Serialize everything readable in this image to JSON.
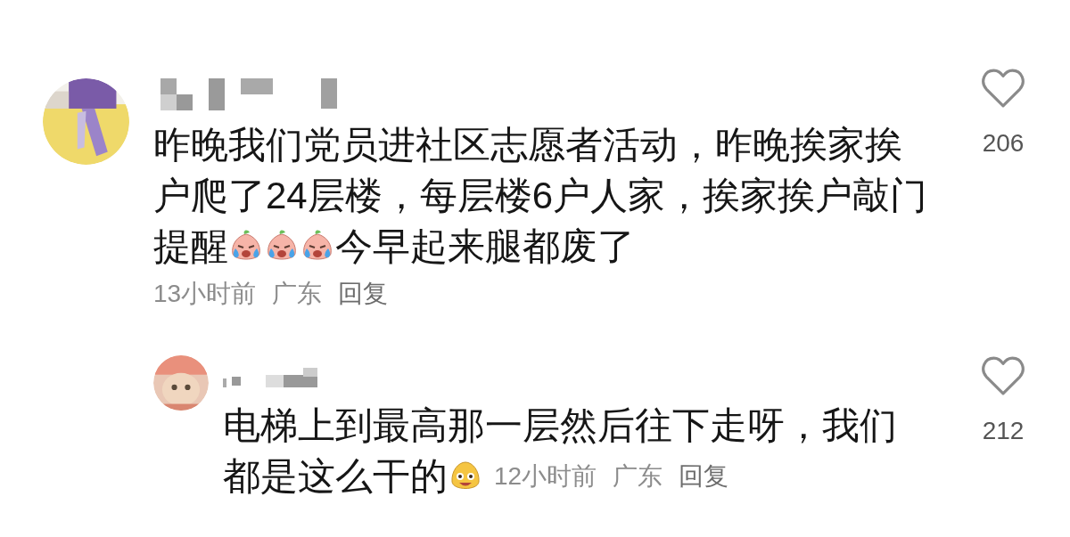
{
  "comments": [
    {
      "avatar": {
        "kind": "picture"
      },
      "liked": false,
      "likes": "206",
      "lines": [
        [
          {
            "kind": "text",
            "text": "昨晚我们党员进社区志愿者活动，昨晚挨家挨"
          }
        ],
        [
          {
            "kind": "text",
            "text": "户爬了24层楼，每层楼6户人家，挨家挨户敲门"
          }
        ],
        [
          {
            "kind": "text",
            "text": "提醒"
          },
          {
            "kind": "crying_emoji"
          },
          {
            "kind": "crying_emoji"
          },
          {
            "kind": "crying_emoji"
          },
          {
            "kind": "text",
            "text": "今早起来腿都废了"
          }
        ]
      ],
      "time": "13小时前",
      "location": "广东",
      "reply": "回复",
      "replies": [
        {
          "avatar": {
            "kind": "picture"
          },
          "liked": false,
          "likes": "212",
          "lines": [
            [
              {
                "kind": "text",
                "text": "电梯上到最高那一层然后往下走呀，我们"
              }
            ],
            [
              {
                "kind": "text",
                "text": "都是这么干的"
              },
              {
                "kind": "grin_emoji"
              }
            ]
          ],
          "time": "12小时前",
          "location": "广东",
          "reply": "回复"
        }
      ]
    }
  ]
}
